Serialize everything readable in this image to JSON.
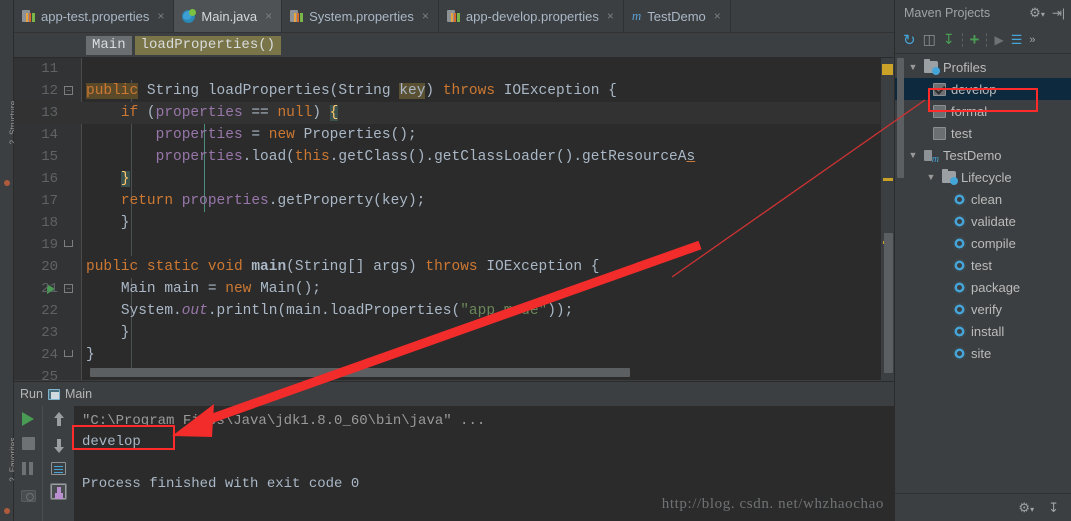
{
  "window": {
    "left_tool_labels": [
      "2. Structure",
      "2. Favorites"
    ]
  },
  "tabs": [
    {
      "label": "app-test.properties",
      "icon": "properties-file-icon",
      "active": false,
      "close": "×"
    },
    {
      "label": "Main.java",
      "icon": "java-class-icon",
      "active": true,
      "close": "×"
    },
    {
      "label": "System.properties",
      "icon": "properties-file-icon",
      "active": false,
      "close": "×"
    },
    {
      "label": "app-develop.properties",
      "icon": "properties-file-icon",
      "active": false,
      "close": "×"
    },
    {
      "label": "TestDemo",
      "icon": "maven-module-icon",
      "active": false,
      "close": "×"
    }
  ],
  "breadcrumb": {
    "class": "Main",
    "method": "loadProperties()"
  },
  "editor": {
    "first_line": 11,
    "lines": [
      {
        "num": "11",
        "text": ""
      },
      {
        "num": "12",
        "text": "    public String loadProperties(String key) throws IOException {"
      },
      {
        "num": "13",
        "text": "        if (properties == null) {"
      },
      {
        "num": "14",
        "text": "            properties = new Properties();"
      },
      {
        "num": "15",
        "text": "            properties.load(this.getClass().getClassLoader().getResourceAs"
      },
      {
        "num": "16",
        "text": "        }"
      },
      {
        "num": "17",
        "text": "        return properties.getProperty(key);"
      },
      {
        "num": "18",
        "text": "    }"
      },
      {
        "num": "19",
        "text": ""
      },
      {
        "num": "20",
        "text": "    public static void main(String[] args) throws IOException {"
      },
      {
        "num": "21",
        "text": "        Main main = new Main();"
      },
      {
        "num": "22",
        "text": "        System.out.println(main.loadProperties(\"app.mode\"));"
      },
      {
        "num": "23",
        "text": "        }"
      },
      {
        "num": "24",
        "text": "    }"
      },
      {
        "num": "25",
        "text": ""
      }
    ]
  },
  "maven": {
    "title": "Maven Projects",
    "toolbar_icons": [
      "reimport-icon",
      "generate-sources-icon",
      "download-sources-icon",
      "add-maven-project-icon",
      "run-icon",
      "execute-goal-icon",
      "more-icon"
    ],
    "title_icons": [
      "settings-gear-icon",
      "hide-panel-icon"
    ],
    "footer_icons": [
      "settings-gear-icon",
      "collapse-icon"
    ],
    "tree": [
      {
        "label": "Profiles",
        "type": "folder",
        "indent": 0,
        "arrow": "▼",
        "selected": false
      },
      {
        "label": "develop",
        "type": "checkbox",
        "indent": 1,
        "checked": true,
        "selected": true
      },
      {
        "label": "formal",
        "type": "checkbox",
        "indent": 1,
        "checked": false,
        "selected": false
      },
      {
        "label": "test",
        "type": "checkbox",
        "indent": 1,
        "checked": false,
        "selected": false
      },
      {
        "label": "TestDemo",
        "type": "module",
        "indent": 0,
        "arrow": "▼",
        "selected": false
      },
      {
        "label": "Lifecycle",
        "type": "folder",
        "indent": 1,
        "arrow": "▼",
        "selected": false
      },
      {
        "label": "clean",
        "type": "goal",
        "indent": 2,
        "selected": false
      },
      {
        "label": "validate",
        "type": "goal",
        "indent": 2,
        "selected": false
      },
      {
        "label": "compile",
        "type": "goal",
        "indent": 2,
        "selected": false
      },
      {
        "label": "test",
        "type": "goal",
        "indent": 2,
        "selected": false
      },
      {
        "label": "package",
        "type": "goal",
        "indent": 2,
        "selected": false
      },
      {
        "label": "verify",
        "type": "goal",
        "indent": 2,
        "selected": false
      },
      {
        "label": "install",
        "type": "goal",
        "indent": 2,
        "selected": false
      },
      {
        "label": "site",
        "type": "goal",
        "indent": 2,
        "selected": false
      }
    ]
  },
  "run_panel": {
    "title": "Run",
    "config_name": "Main",
    "tool_icons": [
      "rerun-icon",
      "stop-icon",
      "pause-icon",
      "screenshot-icon"
    ],
    "tool_icons2": [
      "up-arrow-icon",
      "down-arrow-icon",
      "soft-wrap-icon",
      "scroll-to-end-icon"
    ],
    "console": [
      "\"C:\\Program Files\\Java\\jdk1.8.0_60\\bin\\java\" ...",
      "develop",
      "",
      "Process finished with exit code 0"
    ]
  },
  "watermark": "http://blog. csdn. net/whzhaochao",
  "colors": {
    "accent_red": "#ff2a2a",
    "editor_bg": "#2b2b2b",
    "panel_bg": "#3c3f41",
    "selection_blue": "#0d293e",
    "keyword_orange": "#cc7832",
    "field_purple": "#9876aa",
    "string_green": "#6a8759",
    "text_fg": "#a9b7c6",
    "run_green": "#499c54",
    "gear_blue": "#45a5d8"
  }
}
